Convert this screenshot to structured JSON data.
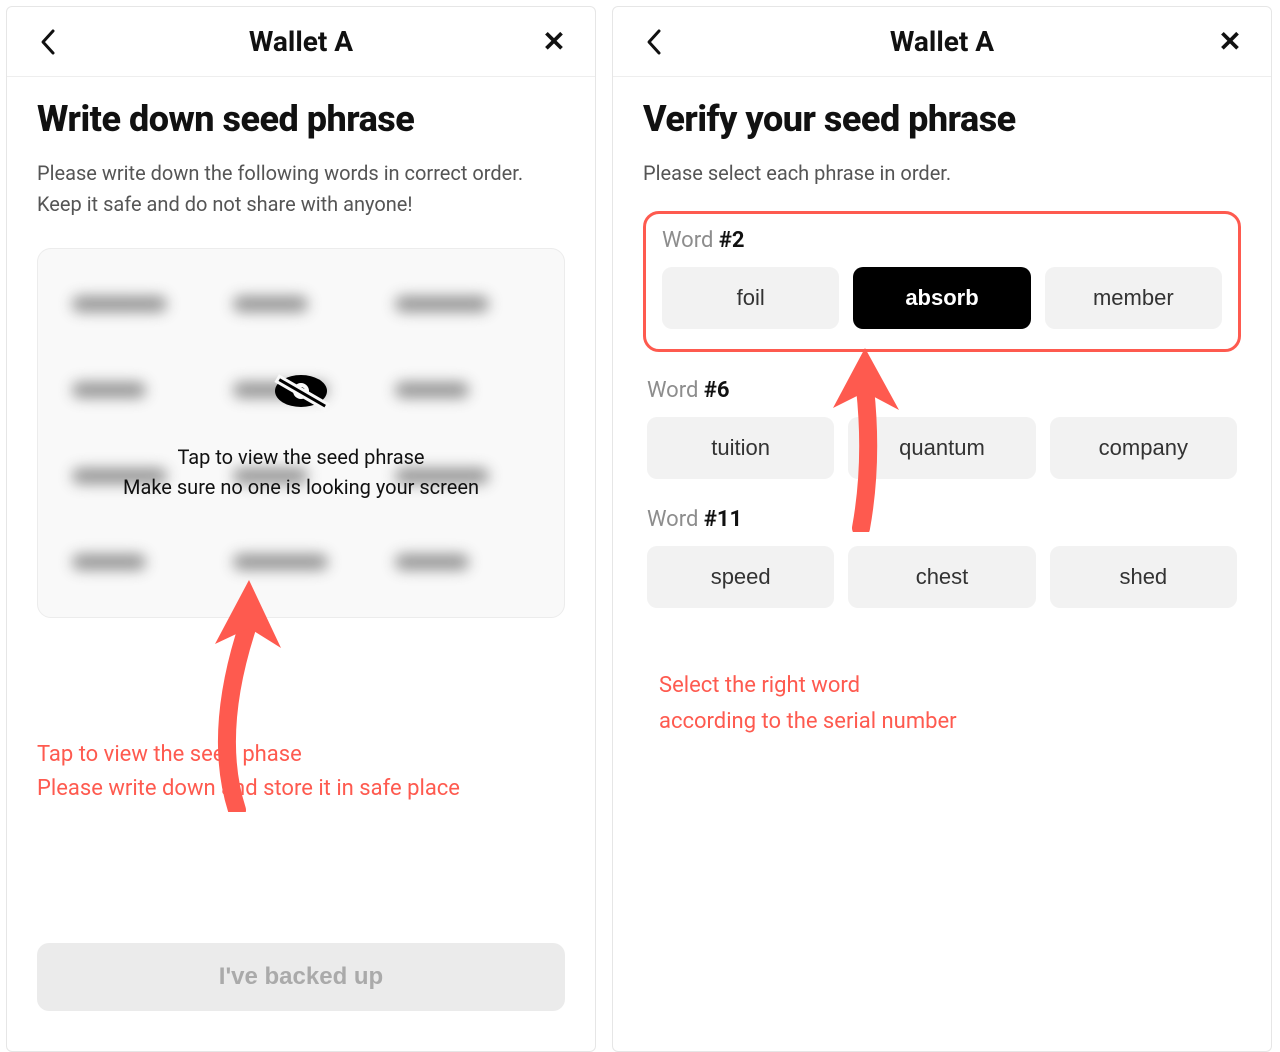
{
  "left": {
    "header": {
      "title": "Wallet A"
    },
    "heading": "Write down seed phrase",
    "subtitle": "Please write down the following words in correct order. Keep it safe and do not share with anyone!",
    "seed": {
      "tap_line1": "Tap to view the seed phrase",
      "tap_line2": "Make sure no one is looking your screen"
    },
    "annotation_line1": "Tap to view the seed phase",
    "annotation_line2": "Please write down and store it in safe place",
    "button_label": "I've backed up"
  },
  "right": {
    "header": {
      "title": "Wallet A"
    },
    "heading": "Verify your seed phrase",
    "subtitle": "Please select each phrase in order.",
    "groups": [
      {
        "label_prefix": "Word ",
        "label_num": "#2",
        "highlighted": true,
        "choices": [
          {
            "text": "foil",
            "selected": false
          },
          {
            "text": "absorb",
            "selected": true
          },
          {
            "text": "member",
            "selected": false
          }
        ]
      },
      {
        "label_prefix": "Word ",
        "label_num": "#6",
        "highlighted": false,
        "choices": [
          {
            "text": "tuition",
            "selected": false
          },
          {
            "text": "quantum",
            "selected": false
          },
          {
            "text": "company",
            "selected": false
          }
        ]
      },
      {
        "label_prefix": "Word ",
        "label_num": "#11",
        "highlighted": false,
        "choices": [
          {
            "text": "speed",
            "selected": false
          },
          {
            "text": "chest",
            "selected": false
          },
          {
            "text": "shed",
            "selected": false
          }
        ]
      }
    ],
    "annotation_line1": "Select the right word",
    "annotation_line2": "according to the serial number"
  }
}
